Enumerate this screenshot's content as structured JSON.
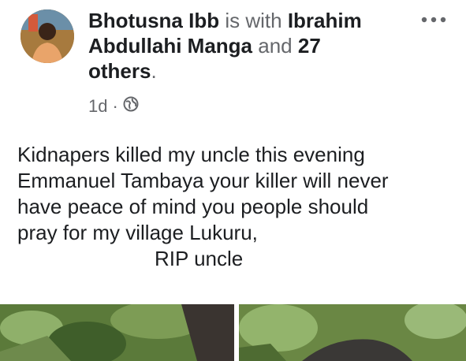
{
  "post": {
    "author": "Bhotusna Ibb",
    "with_text": "is with",
    "tagged_name": "Ibrahim Abdullahi Manga",
    "and_text": "and",
    "others_count": "27",
    "others_text": "others",
    "period": ".",
    "time": "1d",
    "separator": "·",
    "privacy_icon": "globe-icon",
    "more_icon": "more-options-icon",
    "text_lines": [
      "Kidnapers killed my uncle this evening",
      "Emmanuel Tambaya your killer will never",
      "have peace of mind you people should",
      "pray for my village Lukuru,",
      "RIP uncle"
    ]
  },
  "colors": {
    "primary_text": "#1c1e21",
    "secondary_text": "#65676b",
    "background": "#ffffff"
  }
}
